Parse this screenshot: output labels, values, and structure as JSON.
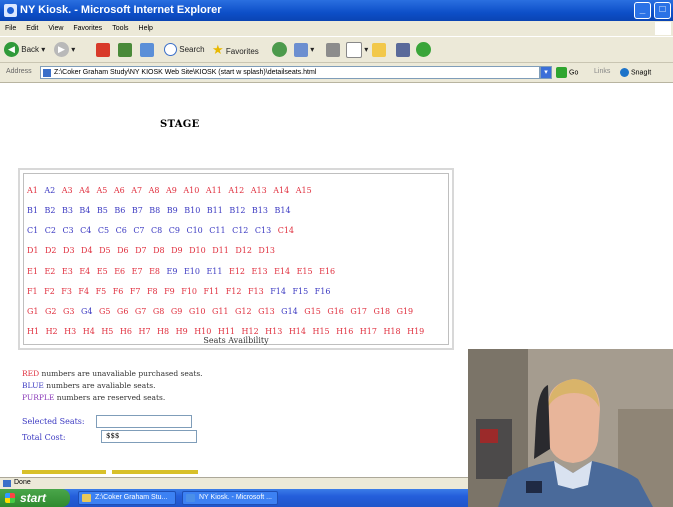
{
  "window": {
    "title": "NY Kiosk. - Microsoft Internet Explorer"
  },
  "menu": [
    "File",
    "Edit",
    "View",
    "Favorites",
    "Tools",
    "Help"
  ],
  "toolbar": {
    "back": "Back",
    "search": "Search",
    "favorites": "Favorites"
  },
  "address": {
    "label": "Address",
    "url": "Z:\\Coker Graham Study\\NY KIOSK Web Site\\KIOSK (start w splash)\\detailseats.html",
    "go": "Go",
    "links": "Links",
    "snagit": "SnagIt"
  },
  "page": {
    "stage_label": "STAGE",
    "seat_caption": "Seats Availbility",
    "rows": [
      {
        "seats": [
          "A1",
          "A2",
          "A3",
          "A4",
          "A5",
          "A6",
          "A7",
          "A8",
          "A9",
          "A10",
          "A11",
          "A12",
          "A13",
          "A14",
          "A15"
        ],
        "colors": [
          "red",
          "blue",
          "red",
          "red",
          "red",
          "red",
          "red",
          "red",
          "red",
          "red",
          "red",
          "red",
          "red",
          "red",
          "red"
        ]
      },
      {
        "seats": [
          "B1",
          "B2",
          "B3",
          "B4",
          "B5",
          "B6",
          "B7",
          "B8",
          "B9",
          "B10",
          "B11",
          "B12",
          "B13",
          "B14"
        ],
        "colors": [
          "blue",
          "blue",
          "blue",
          "blue",
          "blue",
          "blue",
          "blue",
          "blue",
          "blue",
          "blue",
          "blue",
          "blue",
          "blue",
          "blue"
        ]
      },
      {
        "seats": [
          "C1",
          "C2",
          "C3",
          "C4",
          "C5",
          "C6",
          "C7",
          "C8",
          "C9",
          "C10",
          "C11",
          "C12",
          "C13",
          "C14"
        ],
        "colors": [
          "blue",
          "blue",
          "blue",
          "blue",
          "blue",
          "blue",
          "blue",
          "blue",
          "blue",
          "blue",
          "blue",
          "blue",
          "blue",
          "red"
        ]
      },
      {
        "seats": [
          "D1",
          "D2",
          "D3",
          "D4",
          "D5",
          "D6",
          "D7",
          "D8",
          "D9",
          "D10",
          "D11",
          "D12",
          "D13"
        ],
        "colors": [
          "red",
          "red",
          "red",
          "red",
          "red",
          "red",
          "red",
          "red",
          "red",
          "red",
          "red",
          "red",
          "red"
        ]
      },
      {
        "seats": [
          "E1",
          "E2",
          "E3",
          "E4",
          "E5",
          "E6",
          "E7",
          "E8",
          "E9",
          "E10",
          "E11",
          "E12",
          "E13",
          "E14",
          "E15",
          "E16"
        ],
        "colors": [
          "red",
          "red",
          "red",
          "red",
          "red",
          "red",
          "red",
          "red",
          "blue",
          "blue",
          "blue",
          "red",
          "red",
          "red",
          "red",
          "red"
        ]
      },
      {
        "seats": [
          "F1",
          "F2",
          "F3",
          "F4",
          "F5",
          "F6",
          "F7",
          "F8",
          "F9",
          "F10",
          "F11",
          "F12",
          "F13",
          "F14",
          "F15",
          "F16"
        ],
        "colors": [
          "red",
          "red",
          "red",
          "red",
          "red",
          "red",
          "red",
          "red",
          "red",
          "red",
          "red",
          "red",
          "red",
          "blue",
          "blue",
          "blue"
        ]
      },
      {
        "seats": [
          "G1",
          "G2",
          "G3",
          "G4",
          "G5",
          "G6",
          "G7",
          "G8",
          "G9",
          "G10",
          "G11",
          "G12",
          "G13",
          "G14",
          "G15",
          "G16",
          "G17",
          "G18",
          "G19"
        ],
        "colors": [
          "red",
          "red",
          "red",
          "blue",
          "red",
          "red",
          "red",
          "red",
          "red",
          "red",
          "red",
          "red",
          "red",
          "blue",
          "red",
          "red",
          "red",
          "red",
          "red"
        ]
      },
      {
        "seats": [
          "H1",
          "H2",
          "H3",
          "H4",
          "H5",
          "H6",
          "H7",
          "H8",
          "H9",
          "H10",
          "H11",
          "H12",
          "H13",
          "H14",
          "H15",
          "H16",
          "H17",
          "H18",
          "H19"
        ],
        "colors": [
          "red",
          "red",
          "red",
          "red",
          "red",
          "red",
          "red",
          "red",
          "red",
          "red",
          "red",
          "red",
          "red",
          "red",
          "red",
          "red",
          "red",
          "red",
          "red"
        ]
      }
    ],
    "legend": {
      "red_word": "RED",
      "red_text": " numbers are unavaliable purchased seats.",
      "blue_word": "BLUE",
      "blue_text": " numbers are avaliable seats.",
      "purple_word": "PURPLE",
      "purple_text": " numbers are reserved seats."
    },
    "selected_seats_label": "Selected Seats:",
    "selected_seats_value": "",
    "total_cost_label": "Total Cost:",
    "total_cost_value": "$$$"
  },
  "status": {
    "text": "Done"
  },
  "taskbar": {
    "start": "start",
    "tasks": [
      "Z:\\Coker Graham Stu...",
      "NY Kiosk. - Microsoft ..."
    ]
  },
  "colors": {
    "seat_red": "#e0303f",
    "seat_blue": "#3c3ac2",
    "seat_purple": "#8a3ab8",
    "titlebar": "#0d4fc8",
    "taskbar": "#245edb"
  }
}
